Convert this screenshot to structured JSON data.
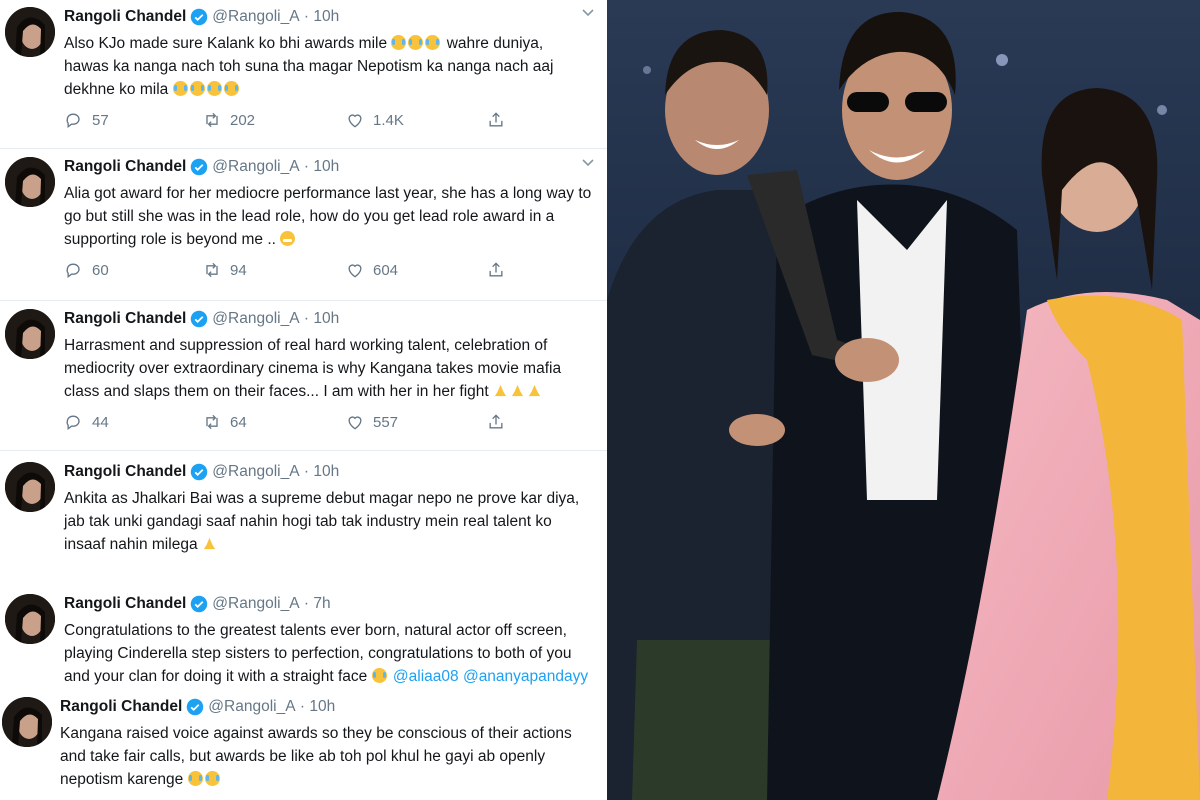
{
  "tweets": [
    {
      "name": "Rangoli Chandel",
      "handle": "@Rangoli_A",
      "time": "10h",
      "lines": [
        "Also KJo made sure Kalank ko bhi awards mile",
        "wahre duniya,",
        "hawas ka nanga nach toh suna tha magar Nepotism ka nanga nach aaj",
        "dekhne ko mila"
      ],
      "replies": "57",
      "retweets": "202",
      "likes": "1.4K"
    },
    {
      "name": "Rangoli Chandel",
      "handle": "@Rangoli_A",
      "time": "10h",
      "lines": [
        "Alia got award for her mediocre performance last year, she has a long way to",
        "go but still she was in the lead role, how do you get lead role award in a",
        "supporting role is beyond me .."
      ],
      "replies": "60",
      "retweets": "94",
      "likes": "604"
    },
    {
      "name": "Rangoli Chandel",
      "handle": "@Rangoli_A",
      "time": "10h",
      "lines": [
        "Harrasment and suppression of real hard working talent, celebration of",
        "mediocrity over extraordinary cinema is why Kangana takes movie mafia",
        "class and slaps them on their faces... I am with her in her fight"
      ],
      "replies": "44",
      "retweets": "64",
      "likes": "557"
    },
    {
      "name": "Rangoli Chandel",
      "handle": "@Rangoli_A",
      "time": "10h",
      "lines": [
        "Ankita as Jhalkari Bai was a supreme debut magar nepo ne prove kar diya,",
        "jab tak unki gandagi saaf nahin hogi tab tak industry mein real talent ko",
        "insaaf nahin milega"
      ]
    },
    {
      "name": "Rangoli Chandel",
      "handle": "@Rangoli_A",
      "time": "7h",
      "lines": [
        "Congratulations to the greatest talents ever born, natural actor off screen,",
        "playing Cinderella step sisters to perfection, congratulations to both of you",
        "and your clan for doing it with a straight face"
      ],
      "mentions": [
        "@aliaa08",
        "@ananyapandayy"
      ]
    },
    {
      "name": "Rangoli Chandel",
      "handle": "@Rangoli_A",
      "time": "10h",
      "lines": [
        "Kangana raised voice against awards so they be conscious of their actions",
        "and take fair calls, but awards be like ab toh pol khul he gayi ab openly",
        "nepotism karenge"
      ]
    }
  ],
  "icons": {
    "reply": "reply-icon",
    "retweet": "retweet-icon",
    "like": "heart-icon",
    "share": "share-icon",
    "verified": "verified-badge-icon",
    "menu": "chevron-down-icon"
  },
  "colors": {
    "verified": "#1da1f2",
    "mention": "#1da1f2",
    "muted": "#657786",
    "text": "#14171a"
  }
}
